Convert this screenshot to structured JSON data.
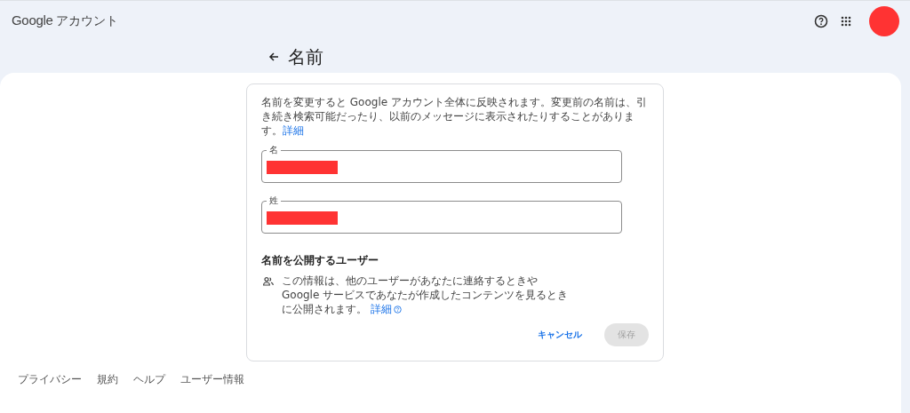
{
  "header": {
    "logo": "Google",
    "product": "アカウント"
  },
  "page": {
    "title": "名前"
  },
  "card": {
    "intro": "名前を変更すると Google アカウント全体に反映されます。変更前の名前は、引き続き検索可能だったり、以前のメッセージに表示されたりすることがあります。",
    "intro_link": "詳細",
    "fields": [
      {
        "label": "名",
        "redacted": true
      },
      {
        "label": "姓",
        "redacted": true
      }
    ],
    "section_title": "名前を公開するユーザー",
    "section_text": "この情報は、他のユーザーがあなたに連絡するときや Google サービスであなたが作成したコンテンツを見るときに公開されます。",
    "section_link": "詳細",
    "buttons": [
      {
        "label": "キャンセル",
        "kind": "text",
        "disabled": false
      },
      {
        "label": "保存",
        "kind": "filled",
        "disabled": true
      }
    ]
  },
  "footer": [
    "プライバシー",
    "規約",
    "ヘルプ",
    "ユーザー情報"
  ]
}
